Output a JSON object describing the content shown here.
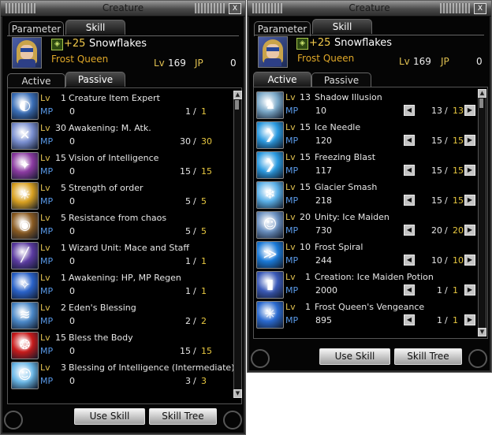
{
  "windows": [
    {
      "title": "Creature",
      "close_label": "X",
      "tabs": {
        "parameter": "Parameter",
        "skill": "Skill"
      },
      "subtabs": {
        "active": "Active",
        "passive": "Passive"
      },
      "plus": "+25",
      "name": "Snowflakes",
      "class_name": "Frost Queen",
      "lv_label": "Lv",
      "level": "169",
      "jp_label": "JP",
      "jp": "0",
      "lv_tag": "Lv",
      "mp_tag": "MP",
      "slash": "/",
      "skills": [
        {
          "icon": "creature-item-expert-icon",
          "level": "1",
          "name": "Creature Item Expert",
          "mp": "0",
          "current": "1",
          "max": "1"
        },
        {
          "icon": "awakening-matk-icon",
          "level": "30",
          "name": "Awakening: M. Atk.",
          "mp": "0",
          "current": "30",
          "max": "30"
        },
        {
          "icon": "vision-of-intelligence-icon",
          "level": "15",
          "name": "Vision of Intelligence",
          "mp": "0",
          "current": "15",
          "max": "15"
        },
        {
          "icon": "strength-of-order-icon",
          "level": "5",
          "name": "Strength of order",
          "mp": "0",
          "current": "5",
          "max": "5"
        },
        {
          "icon": "resistance-from-chaos-icon",
          "level": "5",
          "name": "Resistance from chaos",
          "mp": "0",
          "current": "5",
          "max": "5"
        },
        {
          "icon": "wizard-unit-icon",
          "level": "1",
          "name": "Wizard Unit: Mace and Staff",
          "mp": "0",
          "current": "1",
          "max": "1"
        },
        {
          "icon": "awakening-hp-mp-regen-icon",
          "level": "1",
          "name": "Awakening: HP, MP Regen",
          "mp": "0",
          "current": "1",
          "max": "1"
        },
        {
          "icon": "edens-blessing-icon",
          "level": "2",
          "name": "Eden's Blessing",
          "mp": "0",
          "current": "2",
          "max": "2"
        },
        {
          "icon": "bless-the-body-icon",
          "level": "15",
          "name": "Bless the Body",
          "mp": "0",
          "current": "15",
          "max": "15"
        },
        {
          "icon": "blessing-of-intelligence-icon",
          "level": "3",
          "name": "Blessing of Intelligence (Intermediate)",
          "mp": "0",
          "current": "3",
          "max": "3"
        }
      ],
      "buttons": {
        "use_skill": "Use Skill",
        "skill_tree": "Skill Tree"
      }
    },
    {
      "title": "Creature",
      "close_label": "X",
      "tabs": {
        "parameter": "Parameter",
        "skill": "Skill"
      },
      "subtabs": {
        "active": "Active",
        "passive": "Passive"
      },
      "plus": "+25",
      "name": "Snowflakes",
      "class_name": "Frost Queen",
      "lv_label": "Lv",
      "level": "169",
      "jp_label": "JP",
      "jp": "0",
      "lv_tag": "Lv",
      "mp_tag": "MP",
      "slash": "/",
      "arrow_left": "◀",
      "arrow_right": "▶",
      "skills": [
        {
          "icon": "shadow-illusion-icon",
          "level": "13",
          "name": "Shadow Illusion",
          "mp": "10",
          "current": "13",
          "max": "13"
        },
        {
          "icon": "ice-needle-icon",
          "level": "15",
          "name": "Ice Needle",
          "mp": "120",
          "current": "15",
          "max": "15"
        },
        {
          "icon": "freezing-blast-icon",
          "level": "15",
          "name": "Freezing Blast",
          "mp": "117",
          "current": "15",
          "max": "15"
        },
        {
          "icon": "glacier-smash-icon",
          "level": "15",
          "name": "Glacier Smash",
          "mp": "218",
          "current": "15",
          "max": "15"
        },
        {
          "icon": "unity-ice-maiden-icon",
          "level": "20",
          "name": "Unity: Ice Maiden",
          "mp": "730",
          "current": "20",
          "max": "20"
        },
        {
          "icon": "frost-spiral-icon",
          "level": "10",
          "name": "Frost Spiral",
          "mp": "244",
          "current": "10",
          "max": "10"
        },
        {
          "icon": "creation-ice-maiden-potion-icon",
          "level": "1",
          "name": "Creation: Ice Maiden Potion",
          "mp": "2000",
          "current": "1",
          "max": "1"
        },
        {
          "icon": "frost-queens-vengeance-icon",
          "level": "1",
          "name": "Frost Queen's Vengeance",
          "mp": "895",
          "current": "1",
          "max": "1"
        }
      ],
      "buttons": {
        "use_skill": "Use Skill",
        "skill_tree": "Skill Tree"
      }
    }
  ],
  "icon_colors": {
    "left": [
      "#3a6fb8",
      "#7a8fd0",
      "#8a3aa0",
      "#d8a020",
      "#8a5a20",
      "#5a3aa0",
      "#2a62c8",
      "#4a88c8",
      "#c81a1a",
      "#6ab8e8"
    ],
    "right": [
      "#7aa8c8",
      "#2a9ae0",
      "#2a9ae0",
      "#5ab0e8",
      "#6a90c0",
      "#1a7ad8",
      "#3a5ab8",
      "#2a6ad0"
    ]
  },
  "icon_glyphs": {
    "left": [
      "◐",
      "✕",
      "✦",
      "☀",
      "◉",
      "╱",
      "✧",
      "≋",
      "❂",
      "☺"
    ],
    "right": [
      "♞",
      "❯",
      "❯",
      "❄",
      "☺",
      "≫",
      "▮",
      "✳"
    ]
  }
}
